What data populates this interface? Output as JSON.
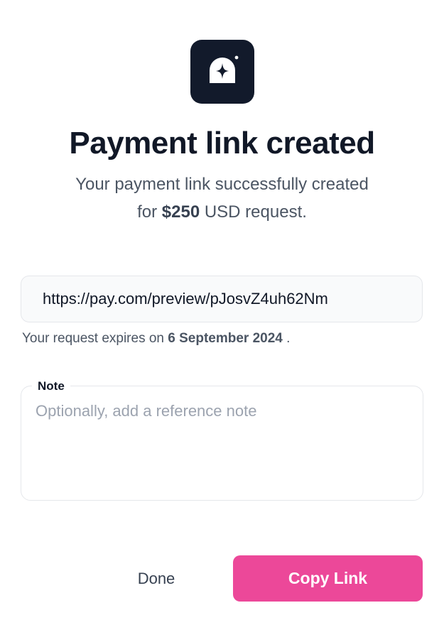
{
  "app": {
    "logo_icon": "sparkle-arch-icon",
    "logo_bg_color": "#121a2b"
  },
  "header": {
    "title": "Payment link created",
    "subtitle_line1": "Your payment link successfully created",
    "subtitle_prefix": "for",
    "amount": "$250",
    "subtitle_suffix": "USD request."
  },
  "link": {
    "url": "https://pay.com/preview/pJosvZ4uh62Nm"
  },
  "expiry": {
    "prefix": "Your request expires on",
    "date": "6 September 2024",
    "suffix": "."
  },
  "note": {
    "label": "Note",
    "placeholder": "Optionally, add a reference note",
    "value": ""
  },
  "actions": {
    "done_label": "Done",
    "copy_label": "Copy Link",
    "accent_color": "#ec4899"
  }
}
